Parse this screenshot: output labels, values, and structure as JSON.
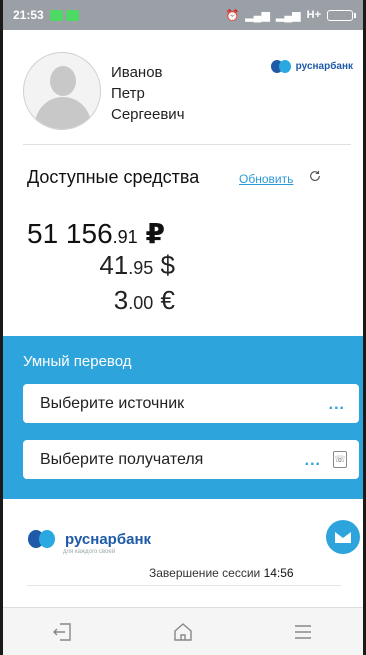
{
  "statusbar": {
    "time": "21:53",
    "network": "H+"
  },
  "profile": {
    "last_name": "Иванов",
    "first_name": "Петр",
    "middle_name": "Сергеевич",
    "bank_name": "руснарбанк"
  },
  "balance": {
    "title": "Доступные средства",
    "refresh_label": "Обновить",
    "rub": {
      "int": "51 156",
      "frac": ".91",
      "symbol": "₽"
    },
    "usd": {
      "int": "41",
      "frac": ".95",
      "symbol": "$"
    },
    "eur": {
      "int": "3",
      "frac": ".00",
      "symbol": "€"
    }
  },
  "transfer": {
    "title": "Умный перевод",
    "source_placeholder": "Выберите источник",
    "dest_placeholder": "Выберите получателя",
    "dots": "..."
  },
  "footer": {
    "bank_name": "руснарбанк",
    "tagline": "для каждого своей",
    "session_label": "Завершение сессии",
    "session_time": "14:56"
  },
  "icons": {
    "nav_left": "logout-icon",
    "nav_center": "home-icon",
    "nav_right": "menu-icon",
    "mail": "mail-icon",
    "refresh": "refresh-icon",
    "contacts": "contacts-icon"
  },
  "colors": {
    "accent": "#2ea4dc",
    "brand": "#1e5aa8"
  }
}
